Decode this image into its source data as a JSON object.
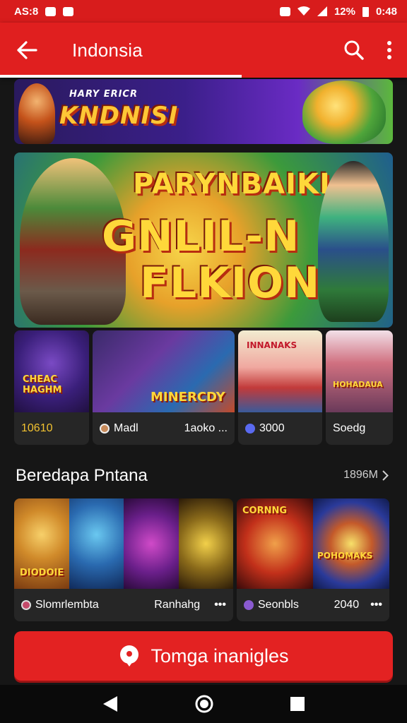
{
  "status_bar": {
    "time_left": "AS:8",
    "battery": "12%",
    "time_right": "0:48"
  },
  "app_bar": {
    "title": "Indonsia"
  },
  "banners": {
    "top_small": "HARY ERICR",
    "top_text": "KNDNISI",
    "main_line1": "PARYNBAIKI",
    "main_line2": "GNLIL-N",
    "main_line3": "FLKIONI"
  },
  "featured_games": [
    {
      "thumb_text": "CHEAC HAGHM",
      "label": "10610",
      "more": ""
    },
    {
      "thumb_text": "MINERCDY",
      "label": "Madl",
      "more": "1aoko ..."
    },
    {
      "thumb_text": "INNANAKS",
      "label": "3000",
      "more": ""
    },
    {
      "thumb_text": "HOHADAUA",
      "label": "Soedg",
      "more": ""
    }
  ],
  "section": {
    "title": "Beredapa Pntana",
    "link": "1896M"
  },
  "section_games": [
    {
      "thumb_texts": [
        "DIODOIE",
        ""
      ],
      "label": "Slomrlembta",
      "more": "Ranhahg"
    },
    {
      "thumb_texts": [
        "CORNNG",
        "POHOMAKS"
      ],
      "label": "Seonbls",
      "more": "2040"
    }
  ],
  "cta": {
    "label": "Tomga inanigles"
  },
  "colors": {
    "accent": "#e01f1f",
    "background": "#161616",
    "card": "#262626"
  }
}
